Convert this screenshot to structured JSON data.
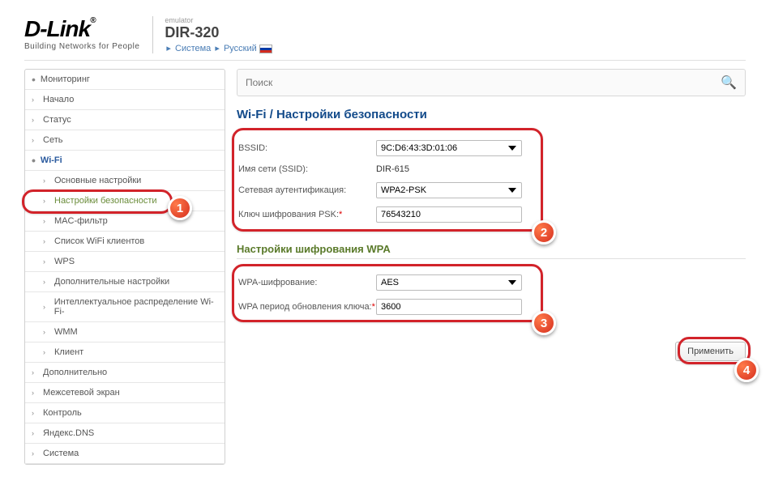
{
  "header": {
    "logo_main": "D-Link",
    "logo_sub": "Building Networks for People",
    "emulator": "emulator",
    "model": "DIR-320",
    "link_system": "Система",
    "link_lang": "Русский"
  },
  "search": {
    "placeholder": "Поиск"
  },
  "sidebar": {
    "items": [
      {
        "label": "Мониторинг",
        "type": "top"
      },
      {
        "label": "Начало",
        "type": "top"
      },
      {
        "label": "Статус",
        "type": "top"
      },
      {
        "label": "Сеть",
        "type": "top"
      },
      {
        "label": "Wi-Fi",
        "type": "expanded"
      },
      {
        "label": "Основные настройки",
        "type": "sub"
      },
      {
        "label": "Настройки безопасности",
        "type": "sub-active"
      },
      {
        "label": "MAC-фильтр",
        "type": "sub"
      },
      {
        "label": "Список WiFi клиентов",
        "type": "sub"
      },
      {
        "label": "WPS",
        "type": "sub"
      },
      {
        "label": "Дополнительные настройки",
        "type": "sub"
      },
      {
        "label": "Интеллектуальное распределение Wi-Fi-",
        "type": "sub"
      },
      {
        "label": "WMM",
        "type": "sub"
      },
      {
        "label": "Клиент",
        "type": "sub"
      },
      {
        "label": "Дополнительно",
        "type": "top"
      },
      {
        "label": "Межсетевой экран",
        "type": "top"
      },
      {
        "label": "Контроль",
        "type": "top"
      },
      {
        "label": "Яндекс.DNS",
        "type": "top"
      },
      {
        "label": "Система",
        "type": "top"
      }
    ]
  },
  "main": {
    "title": "Wi-Fi /  Настройки безопасности",
    "bssid_label": "BSSID:",
    "bssid_value": "9C:D6:43:3D:01:06",
    "ssid_label": "Имя сети (SSID):",
    "ssid_value": "DIR-615",
    "auth_label": "Сетевая аутентификация:",
    "auth_value": "WPA2-PSK",
    "psk_label": "Ключ шифрования PSK:",
    "psk_value": "76543210",
    "wpa_section": "Настройки шифрования WPA",
    "wpa_enc_label": "WPA-шифрование:",
    "wpa_enc_value": "AES",
    "wpa_period_label": "WPA период обновления ключа:",
    "wpa_period_value": "3600",
    "apply_btn": "Применить"
  },
  "annotations": {
    "b1": "1",
    "b2": "2",
    "b3": "3",
    "b4": "4"
  }
}
